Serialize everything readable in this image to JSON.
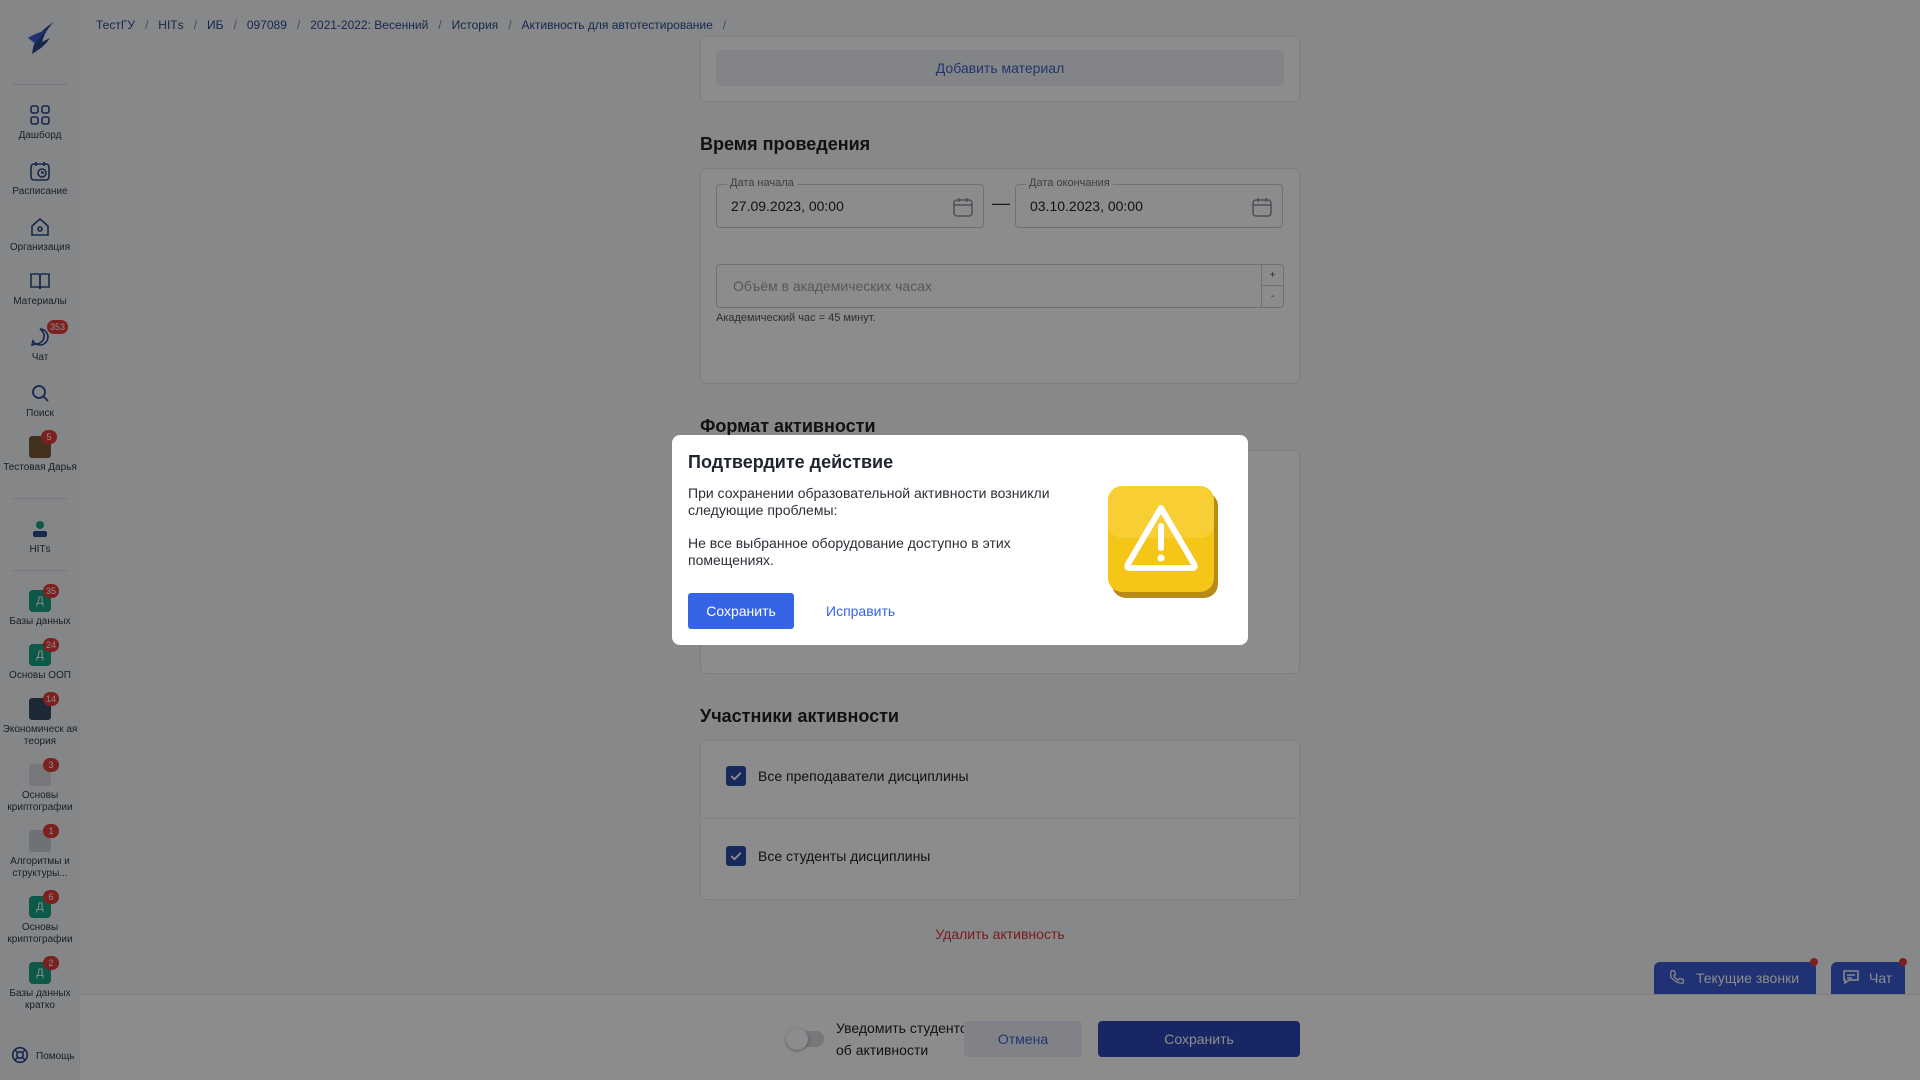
{
  "breadcrumb": [
    "ТестГУ",
    "НІТs",
    "ИБ",
    "097089",
    "2021-2022: Весенний",
    "История",
    "Активность для автотестирование"
  ],
  "sidebar": {
    "items": [
      {
        "label": "Дашборд",
        "icon": "grid-icon"
      },
      {
        "label": "Расписание",
        "icon": "schedule-icon"
      },
      {
        "label": "Организация",
        "icon": "home-icon"
      },
      {
        "label": "Материалы",
        "icon": "book-icon"
      },
      {
        "label": "Чат",
        "icon": "chat-icon",
        "badge": "353"
      },
      {
        "label": "Поиск",
        "icon": "search-icon"
      },
      {
        "label": "Тестовая Дарья",
        "icon": "user-avatar-icon",
        "badge": "5"
      }
    ],
    "org": {
      "label": "НІТs",
      "icon": "org-logo-icon"
    },
    "courses": [
      {
        "label": "Базы данных",
        "letter": "Д",
        "badge": "35"
      },
      {
        "label": "Основы ООП",
        "letter": "Д",
        "badge": "24"
      },
      {
        "label": "Экономическ ая теория",
        "letter": "",
        "badge": "14"
      },
      {
        "label": "Основы криптографии",
        "letter": "",
        "badge": "3"
      },
      {
        "label": "Алгоритмы и структуры...",
        "letter": "",
        "badge": "1"
      },
      {
        "label": "Основы криптографии",
        "letter": "Д",
        "badge": "6"
      },
      {
        "label": "Базы данных кратко",
        "letter": "Д",
        "badge": "2"
      }
    ],
    "help": "Помощь"
  },
  "main": {
    "add_material": "Добавить материал",
    "time_title": "Время проведения",
    "start": {
      "label": "Дата начала",
      "value": "27.09.2023, 00:00"
    },
    "end": {
      "label": "Дата окончания",
      "value": "03.10.2023, 00:00"
    },
    "dash": "—",
    "hours_placeholder": "Объём в академических часах",
    "stepper_plus": "+",
    "stepper_minus": "-",
    "hours_hint": "Академический час = 45 минут.",
    "format_title": "Формат активности",
    "participants_title": "Участники активности",
    "all_teachers": "Все преподаватели дисциплины",
    "all_students": "Все студенты дисциплины",
    "delete": "Удалить активность"
  },
  "floating": {
    "calls": "Текущие звонки",
    "chat": "Чат"
  },
  "bottom": {
    "notify_line1": "Уведомить студентов",
    "notify_line2": "об активности",
    "cancel": "Отмена",
    "save": "Сохранить"
  },
  "modal": {
    "title": "Подтвердите действие",
    "text1": "При сохранении образовательной активности возникли следующие проблемы:",
    "text2": "Не все выбранное оборудование доступно в этих помещениях.",
    "save": "Сохранить",
    "fix": "Исправить"
  },
  "colors": {
    "accent": "#3565e6",
    "primary_dark": "#2d47b4",
    "danger": "#e03131",
    "warning": "#f5c518"
  }
}
